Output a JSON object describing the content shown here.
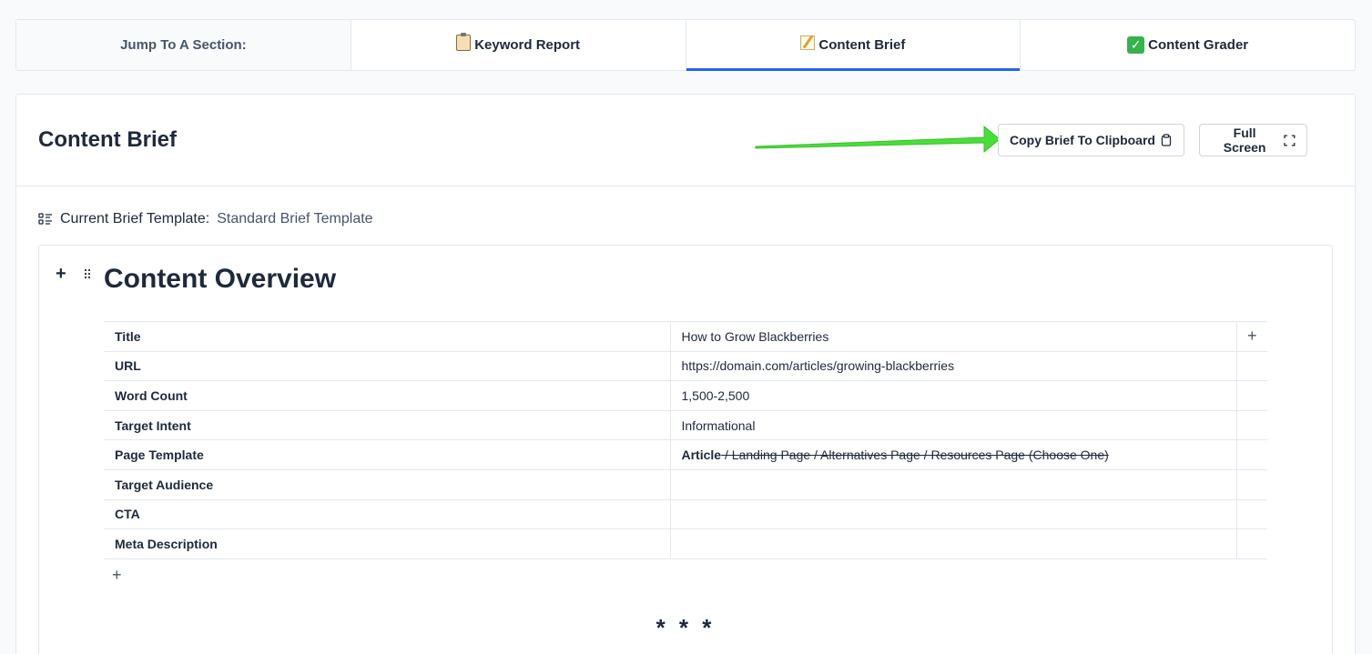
{
  "tabs": [
    {
      "label": "Jump To A Section:",
      "icon": ""
    },
    {
      "label": "Keyword Report",
      "icon": "clipboard-icon"
    },
    {
      "label": "Content Brief",
      "icon": "memo-icon",
      "active": true
    },
    {
      "label": "Content Grader",
      "icon": "check-mark-icon"
    }
  ],
  "header": {
    "title": "Content Brief",
    "copy_label": "Copy Brief To Clipboard",
    "full_label": "Full Screen"
  },
  "template": {
    "label": "Current Brief Template:",
    "value": "Standard Brief Template"
  },
  "editor": {
    "heading": "Content Overview",
    "rows": [
      {
        "key": "Title",
        "value": "How to Grow Blackberries"
      },
      {
        "key": "URL",
        "value": "https://domain.com/articles/growing-blackberries"
      },
      {
        "key": "Word Count",
        "value": "1,500-2,500"
      },
      {
        "key": "Target Intent",
        "value": "Informational"
      },
      {
        "key": "Page Template",
        "value_bold": "Article",
        "value_strike": " / Landing Page / Alternatives Page / Resources Page (Choose One)"
      },
      {
        "key": "Target Audience",
        "value": ""
      },
      {
        "key": "CTA",
        "value": ""
      },
      {
        "key": "Meta Description",
        "value": ""
      }
    ],
    "divider": "* * *"
  },
  "colors": {
    "accent": "#2563eb",
    "arrow": "#4ade3b"
  }
}
